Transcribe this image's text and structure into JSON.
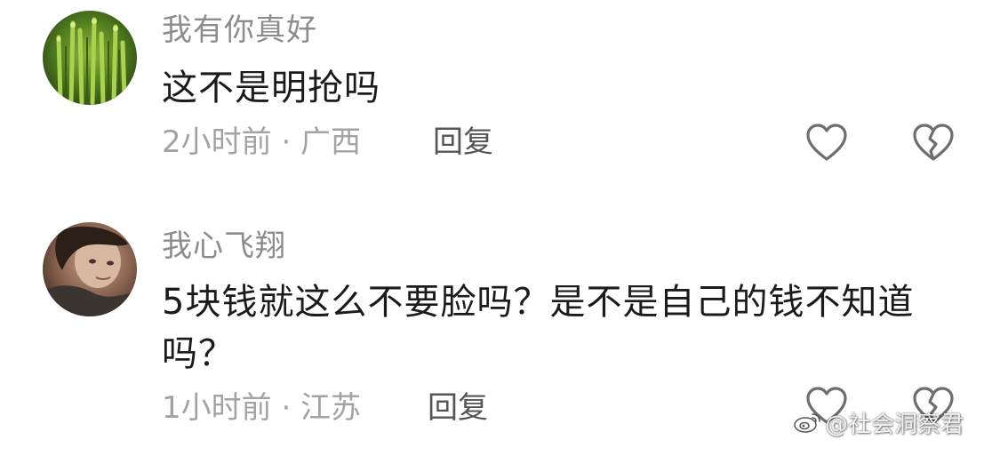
{
  "comments": [
    {
      "username": "我有你真好",
      "content": "这不是明抢吗",
      "meta": "2小时前 · 广西",
      "reply_label": "回复",
      "avatar_icon": "cactus-avatar-icon",
      "like_icon": "heart-outline-icon",
      "dislike_icon": "broken-heart-icon"
    },
    {
      "username": "我心飞翔",
      "content": "5块钱就这么不要脸吗？是不是自己的钱不知道吗？",
      "meta": "1小时前 · 江苏",
      "reply_label": "回复",
      "avatar_icon": "person-photo-avatar-icon",
      "like_icon": "heart-outline-icon",
      "dislike_icon": "broken-heart-icon"
    }
  ],
  "watermark": {
    "text": "@社会洞察君",
    "icon": "weibo-logo-icon"
  },
  "colors": {
    "background": "#ffffff",
    "username": "#8c8c8c",
    "content": "#1b1b1b",
    "meta": "#a3a3a3",
    "reply": "#555555",
    "icon_stroke": "#6e6e6e"
  }
}
